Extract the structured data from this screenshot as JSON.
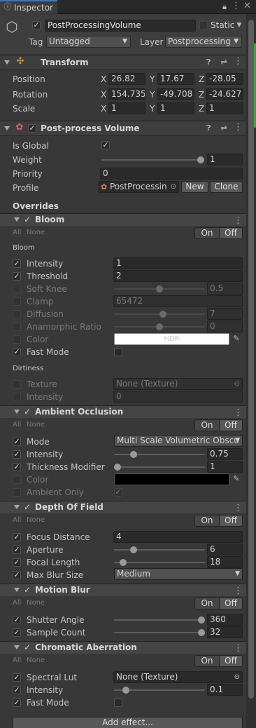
{
  "tab": {
    "title": "Inspector"
  },
  "object": {
    "name": "PostProcessingVolume",
    "static_label": "Static",
    "tag_label": "Tag",
    "tag_value": "Untagged",
    "layer_label": "Layer",
    "layer_value": "Postprocessing"
  },
  "transform": {
    "title": "Transform",
    "position": {
      "label": "Position",
      "x": "26.82",
      "y": "17.67",
      "z": "-28.05"
    },
    "rotation": {
      "label": "Rotation",
      "x": "154.735",
      "y": "-49.708",
      "z": "-24.627"
    },
    "scale": {
      "label": "Scale",
      "x": "1",
      "y": "1",
      "z": "1"
    }
  },
  "volume": {
    "title": "Post-process Volume",
    "is_global": "Is Global",
    "weight": "Weight",
    "weight_value": "1",
    "weight_level": 1.0,
    "priority": "Priority",
    "priority_value": "0",
    "profile": "Profile",
    "profile_value": "PostProcessin",
    "new": "New",
    "clone": "Clone",
    "overrides": "Overrides"
  },
  "axis": {
    "x": "X",
    "y": "Y",
    "z": "Z"
  },
  "common": {
    "all": "All",
    "none": "None",
    "on": "On",
    "off": "Off"
  },
  "bloom": {
    "title": "Bloom",
    "section1": "Bloom",
    "section2": "Dirtiness",
    "intensity": "Intensity",
    "intensity_value": "1",
    "threshold": "Threshold",
    "threshold_value": "2",
    "soft_knee": "Soft Knee",
    "soft_knee_value": "0.5",
    "clamp": "Clamp",
    "clamp_value": "65472",
    "diffusion": "Diffusion",
    "diffusion_value": "7",
    "anamorphic": "Anamorphic Ratio",
    "anamorphic_value": "0",
    "color": "Color",
    "color_value": "HDR",
    "fast_mode": "Fast Mode",
    "texture": "Texture",
    "texture_value": "None (Texture)",
    "dirt_intensity": "Intensity",
    "dirt_intensity_value": "0"
  },
  "ao": {
    "title": "Ambient Occlusion",
    "mode": "Mode",
    "mode_value": "Multi Scale Volumetric Obscu",
    "intensity": "Intensity",
    "intensity_value": "0.75",
    "thickness": "Thickness Modifier",
    "thickness_value": "1",
    "color": "Color",
    "ambient_only": "Ambient Only"
  },
  "dof": {
    "title": "Depth Of Field",
    "focus": "Focus Distance",
    "focus_value": "4",
    "aperture": "Aperture",
    "aperture_value": "6",
    "focal": "Focal Length",
    "focal_value": "18",
    "blur": "Max Blur Size",
    "blur_value": "Medium"
  },
  "motion": {
    "title": "Motion Blur",
    "shutter": "Shutter Angle",
    "shutter_value": "360",
    "sample": "Sample Count",
    "sample_value": "32"
  },
  "chroma": {
    "title": "Chromatic Aberration",
    "lut": "Spectral Lut",
    "lut_value": "None (Texture)",
    "intensity": "Intensity",
    "intensity_value": "0.1",
    "fast": "Fast Mode"
  },
  "add_effect": "Add effect...",
  "colors": {
    "background": "#383838",
    "header": "#3e3e3e",
    "field": "#2a2a2a",
    "accent_dot": "#2f2"
  }
}
